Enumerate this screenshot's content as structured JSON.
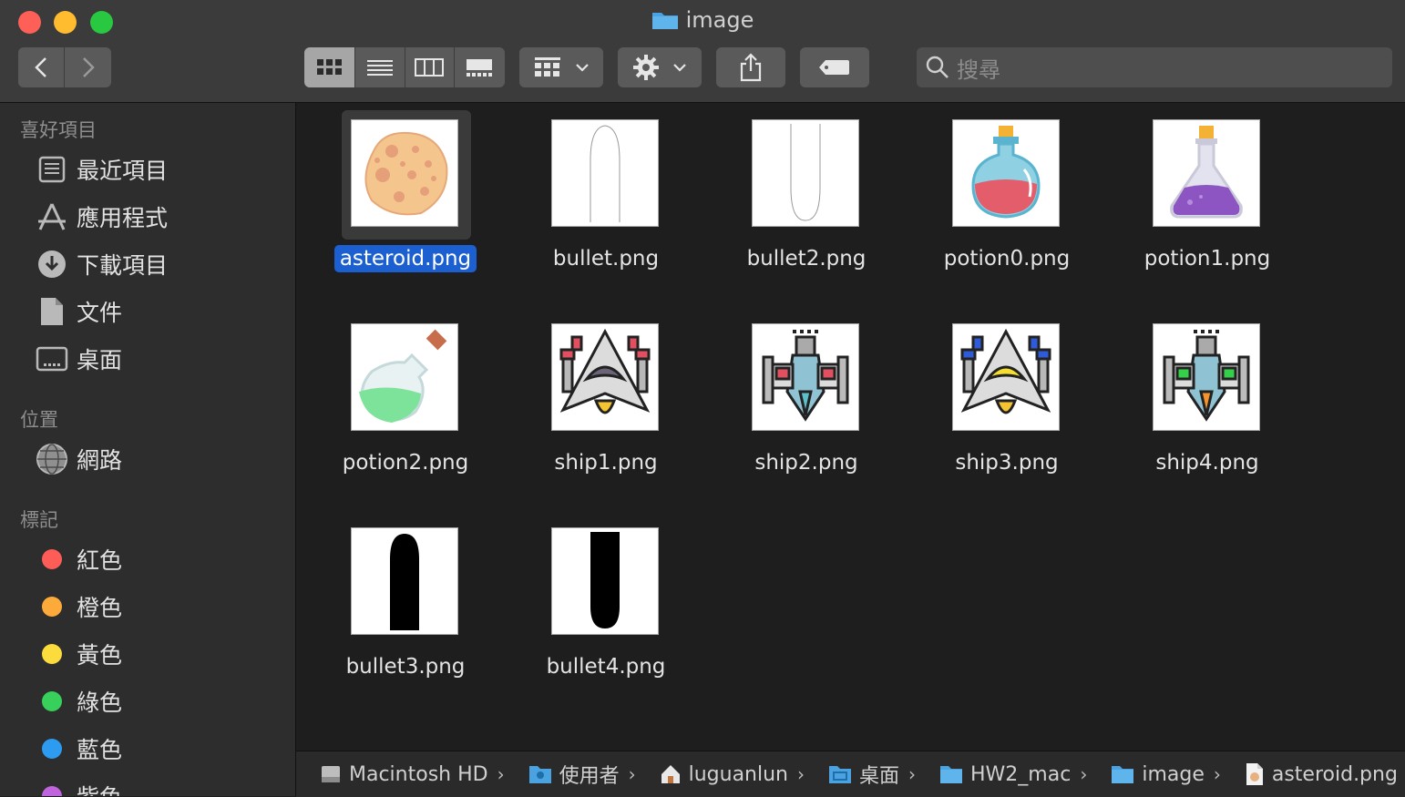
{
  "window": {
    "title": "image"
  },
  "toolbar": {
    "search_placeholder": "搜尋"
  },
  "sidebar": {
    "favorites_header": "喜好項目",
    "favorites": [
      {
        "label": "最近項目",
        "icon": "recents-icon"
      },
      {
        "label": "應用程式",
        "icon": "applications-icon"
      },
      {
        "label": "下載項目",
        "icon": "downloads-icon"
      },
      {
        "label": "文件",
        "icon": "documents-icon"
      },
      {
        "label": "桌面",
        "icon": "desktop-icon"
      }
    ],
    "locations_header": "位置",
    "locations": [
      {
        "label": "網路",
        "icon": "network-icon"
      }
    ],
    "tags_header": "標記",
    "tags": [
      {
        "label": "紅色",
        "color": "#fe5c57"
      },
      {
        "label": "橙色",
        "color": "#fcab3a"
      },
      {
        "label": "黃色",
        "color": "#fcdb3c"
      },
      {
        "label": "綠色",
        "color": "#36d05a"
      },
      {
        "label": "藍色",
        "color": "#2d9bf0"
      },
      {
        "label": "紫色",
        "color": "#c064dd"
      }
    ]
  },
  "files": [
    {
      "name": "asteroid.png",
      "icon": "asteroid-icon",
      "selected": true
    },
    {
      "name": "bullet.png",
      "icon": "bullet-outline-icon"
    },
    {
      "name": "bullet2.png",
      "icon": "bullet2-outline-icon"
    },
    {
      "name": "potion0.png",
      "icon": "red-potion-icon"
    },
    {
      "name": "potion1.png",
      "icon": "purple-potion-icon"
    },
    {
      "name": "potion2.png",
      "icon": "green-potion-icon"
    },
    {
      "name": "ship1.png",
      "icon": "ship1-icon"
    },
    {
      "name": "ship2.png",
      "icon": "ship2-icon"
    },
    {
      "name": "ship3.png",
      "icon": "ship3-icon"
    },
    {
      "name": "ship4.png",
      "icon": "ship4-icon"
    },
    {
      "name": "bullet3.png",
      "icon": "bullet-solid-icon"
    },
    {
      "name": "bullet4.png",
      "icon": "bullet4-solid-icon"
    }
  ],
  "pathbar": [
    {
      "label": "Macintosh HD",
      "icon": "disk-icon"
    },
    {
      "label": "使用者",
      "icon": "users-folder-icon"
    },
    {
      "label": "luguanlun",
      "icon": "home-icon"
    },
    {
      "label": "桌面",
      "icon": "desktop-folder-icon"
    },
    {
      "label": "HW2_mac",
      "icon": "folder-icon"
    },
    {
      "label": "image",
      "icon": "folder-icon"
    },
    {
      "label": "asteroid.png",
      "icon": "png-file-icon"
    }
  ]
}
